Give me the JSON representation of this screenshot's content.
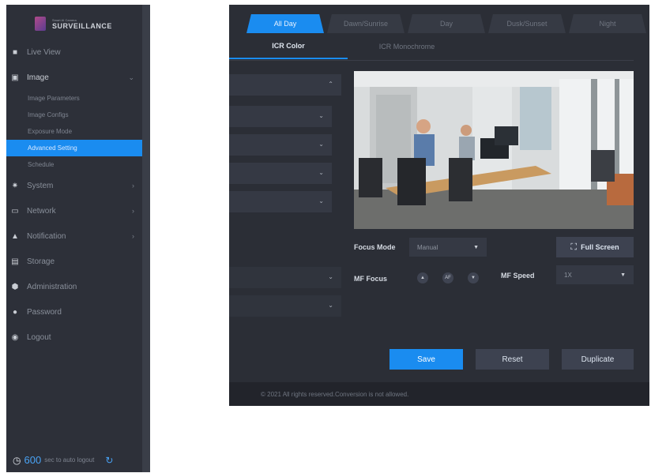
{
  "logo": {
    "subtitle": "Smart AI Camera",
    "title": "SURVEILLANCE"
  },
  "sidebar": {
    "items": [
      {
        "label": "Live View",
        "icon": "camera-icon"
      },
      {
        "label": "Image",
        "icon": "image-icon"
      },
      {
        "label": "System",
        "icon": "gear-icon"
      },
      {
        "label": "Network",
        "icon": "monitor-icon"
      },
      {
        "label": "Notification",
        "icon": "bell-icon"
      },
      {
        "label": "Storage",
        "icon": "storage-icon"
      },
      {
        "label": "Administration",
        "icon": "shield-icon"
      },
      {
        "label": "Password",
        "icon": "user-icon"
      },
      {
        "label": "Logout",
        "icon": "power-icon"
      }
    ],
    "subitems": [
      "Image Parameters",
      "Image Configs",
      "Exposure Mode",
      "Advanced Setting",
      "Schedule"
    ],
    "active_subitem": "Advanced Setting"
  },
  "autologout": {
    "seconds": "600",
    "text": "sec to auto logout"
  },
  "tabs": [
    "All Day",
    "Dawn/Sunrise",
    "Day",
    "Dusk/Sunset",
    "Night"
  ],
  "active_tab": "All Day",
  "subtabs": [
    "ICR Color",
    "ICR Monochrome"
  ],
  "active_subtab": "ICR Color",
  "controls": {
    "focus_mode_label": "Focus Mode",
    "focus_mode_value": "Manual",
    "full_screen_label": "Full Screen",
    "mf_focus_label": "MF Focus",
    "mf_focus_buttons": [
      "▲",
      "AF",
      "▼"
    ],
    "mf_speed_label": "MF Speed",
    "mf_speed_value": "1X"
  },
  "actions": {
    "save": "Save",
    "reset": "Reset",
    "duplicate": "Duplicate"
  },
  "footer": {
    "text": "© 2021 All rights reserved.Conversion is not allowed."
  },
  "colors": {
    "accent": "#1a8cf0",
    "panel": "#2b2e36",
    "sidebar": "#2d3039"
  }
}
